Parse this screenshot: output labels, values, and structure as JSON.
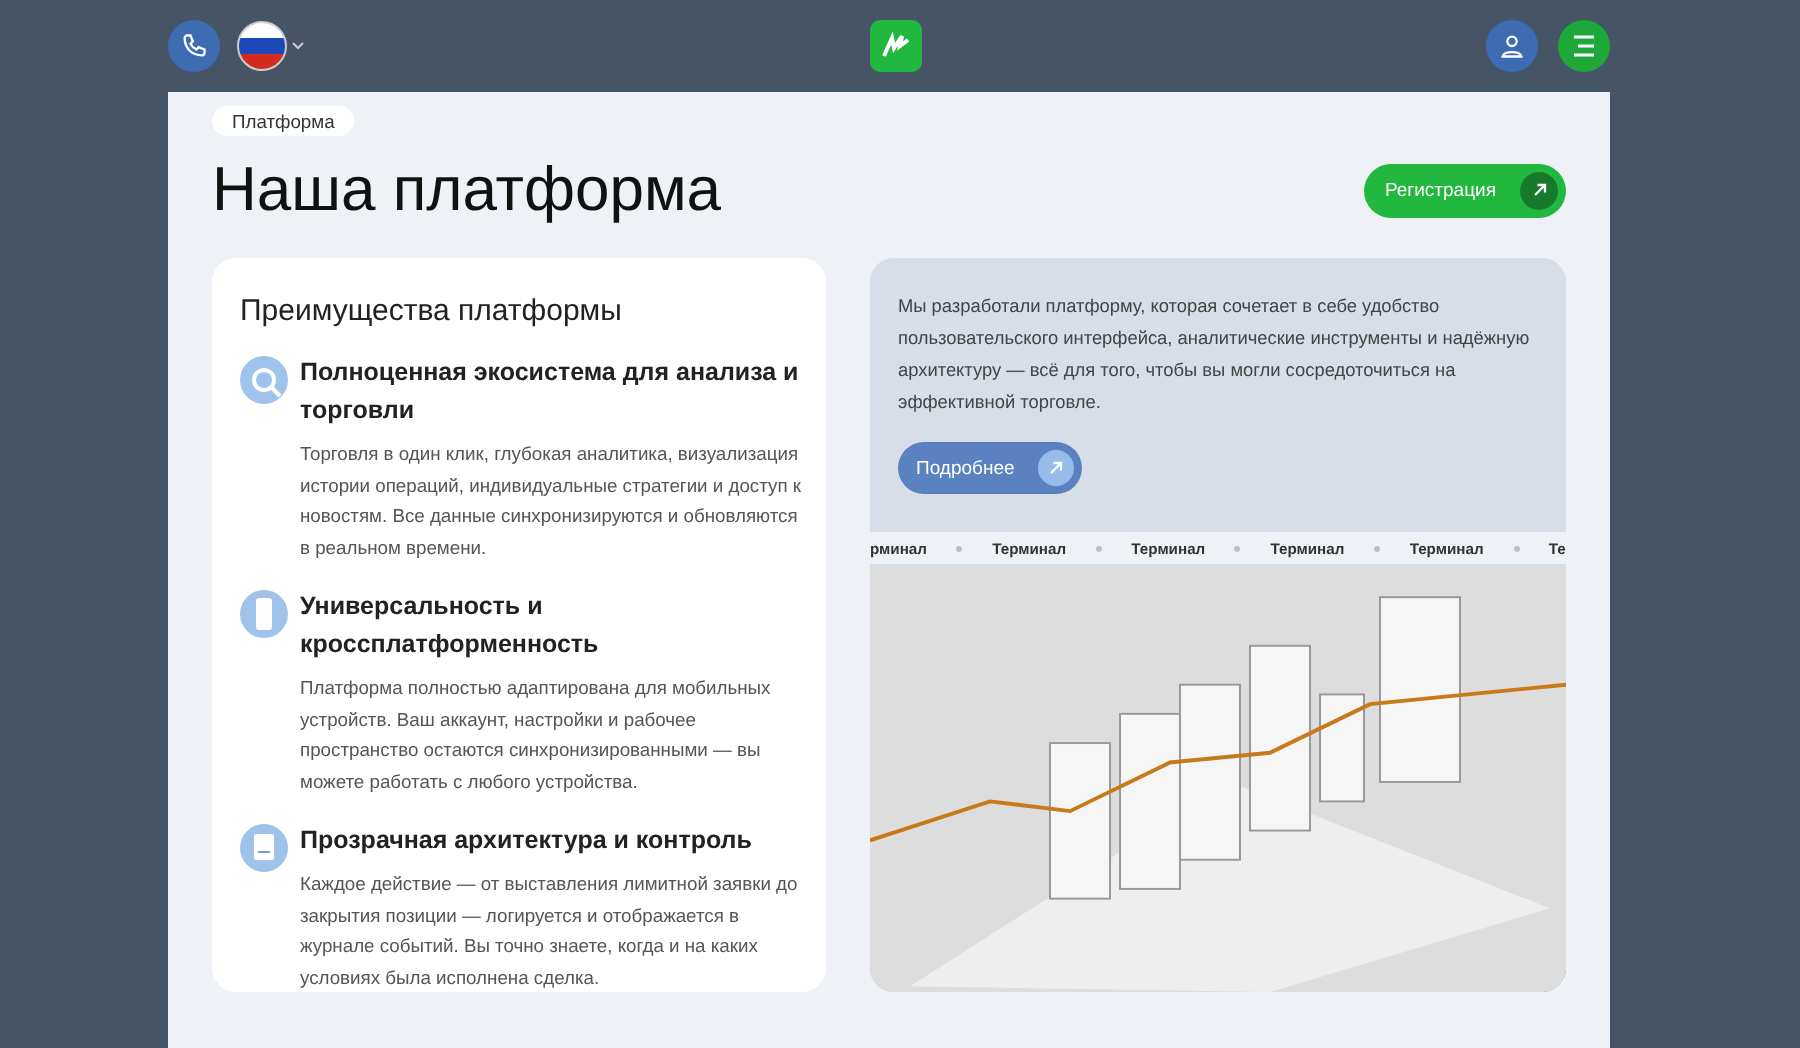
{
  "breadcrumb": "Платформа",
  "title": "Наша платформа",
  "register_button": "Регистрация",
  "advantages": {
    "heading": "Преимущества платформы",
    "items": [
      {
        "title": "Полноценная экосистема для анализа и торговли",
        "description": "Торговля в один клик, глубокая аналитика, визуализация истории операций, индивидуальные стратегии и доступ к новостям. Все данные синхронизируются и обновляются в реальном времени."
      },
      {
        "title": "Универсальность и кроссплатформенность",
        "description": "Платформа полностью адаптирована для мобильных устройств. Ваш аккаунт, настройки и рабочее пространство остаются синхронизированными — вы можете работать с любого устройства."
      },
      {
        "title": "Прозрачная архитектура и контроль",
        "description": "Каждое действие — от выставления лимитной заявки до закрытия позиции — логируется и отображается в журнале событий. Вы точно знаете, когда и на каких условиях была исполнена сделка."
      }
    ]
  },
  "promo": {
    "text": "Мы разработали платформу, которая сочетает в себе удобство пользовательского интерфейса, аналитические инструменты и надёжную архитектуру — всё для того, чтобы вы могли сосредоточиться на эффективной торговле.",
    "button": "Подробнее",
    "ticker": [
      "рминал",
      "Терминал",
      "Терминал",
      "Терминал",
      "Терминал",
      "Те"
    ]
  }
}
